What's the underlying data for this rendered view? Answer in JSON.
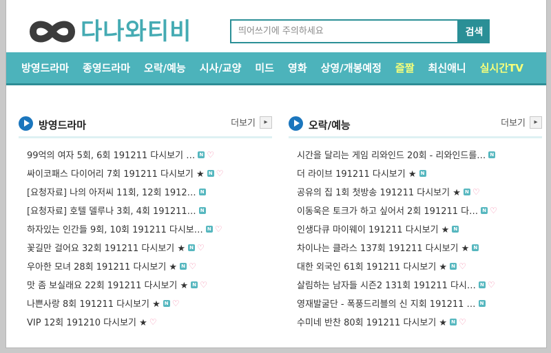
{
  "logo": {
    "text": "다나와티비"
  },
  "search": {
    "placeholder": "띄어쓰기에 주의하세요",
    "button_label": "검색"
  },
  "nav": {
    "items": [
      {
        "label": "방영드라마",
        "highlight": false
      },
      {
        "label": "종영드라마",
        "highlight": false
      },
      {
        "label": "오락/예능",
        "highlight": false
      },
      {
        "label": "시사/교양",
        "highlight": false
      },
      {
        "label": "미드",
        "highlight": false
      },
      {
        "label": "영화",
        "highlight": false
      },
      {
        "label": "상영/개봉예정",
        "highlight": false
      },
      {
        "label": "즐짤",
        "highlight": true
      },
      {
        "label": "최신애니",
        "highlight": false
      },
      {
        "label": "실시간TV",
        "highlight": true
      }
    ]
  },
  "colors": {
    "accent": "#4cb3bb",
    "accent_dark": "#2a8f96",
    "highlight": "#f6ff7a",
    "play_icon": "#1b76bd"
  },
  "sections": [
    {
      "title": "방영드라마",
      "more_label": "더보기",
      "items": [
        {
          "text": "99억의 여자 5회, 6회 191211 다시보기 …",
          "new": true,
          "heart": true
        },
        {
          "text": "싸이코패스 다이어리 7회 191211 다시보기 ★",
          "new": true,
          "heart": true
        },
        {
          "text": "[요청자료] 나의 아저씨 11회, 12회 1912…",
          "new": true,
          "heart": false
        },
        {
          "text": "[요청자료] 호텔 델루나 3회, 4회 191211…",
          "new": true,
          "heart": false
        },
        {
          "text": "하자있는 인간들 9회, 10회 191211 다시보…",
          "new": true,
          "heart": true
        },
        {
          "text": "꽃길만 걸어요 32회 191211 다시보기 ★",
          "new": true,
          "heart": true
        },
        {
          "text": "우아한 모녀 28회 191211 다시보기 ★",
          "new": true,
          "heart": true
        },
        {
          "text": "맛 좀 보실래요 22회 191211 다시보기 ★",
          "new": true,
          "heart": true
        },
        {
          "text": "나쁜사랑 8회 191211 다시보기 ★",
          "new": true,
          "heart": true
        },
        {
          "text": "VIP 12회 191210 다시보기 ★",
          "new": false,
          "heart": true
        }
      ]
    },
    {
      "title": "오락/예능",
      "more_label": "더보기",
      "items": [
        {
          "text": "시간을 달리는 게임 리와인드 20회 - 리와인드를…",
          "new": true,
          "heart": false
        },
        {
          "text": "더 라이브 191211 다시보기 ★",
          "new": true,
          "heart": false
        },
        {
          "text": "공유의 집 1회 첫방송 191211 다시보기 ★",
          "new": true,
          "heart": true
        },
        {
          "text": "이동욱은 토크가 하고 싶어서 2회 191211 다…",
          "new": true,
          "heart": true
        },
        {
          "text": "인생다큐 마이웨이 191211 다시보기 ★",
          "new": true,
          "heart": false
        },
        {
          "text": "차이나는 클라스 137회 191211 다시보기 ★",
          "new": true,
          "heart": false
        },
        {
          "text": "대한 외국인 61회 191211 다시보기 ★",
          "new": true,
          "heart": true
        },
        {
          "text": "살림하는 남자들 시즌2 131회 191211 다시…",
          "new": true,
          "heart": true
        },
        {
          "text": "영재발굴단 - 폭풍드리블의 신 지회 191211 …",
          "new": true,
          "heart": false
        },
        {
          "text": "수미네 반찬 80회 191211 다시보기 ★",
          "new": true,
          "heart": true
        }
      ]
    }
  ]
}
